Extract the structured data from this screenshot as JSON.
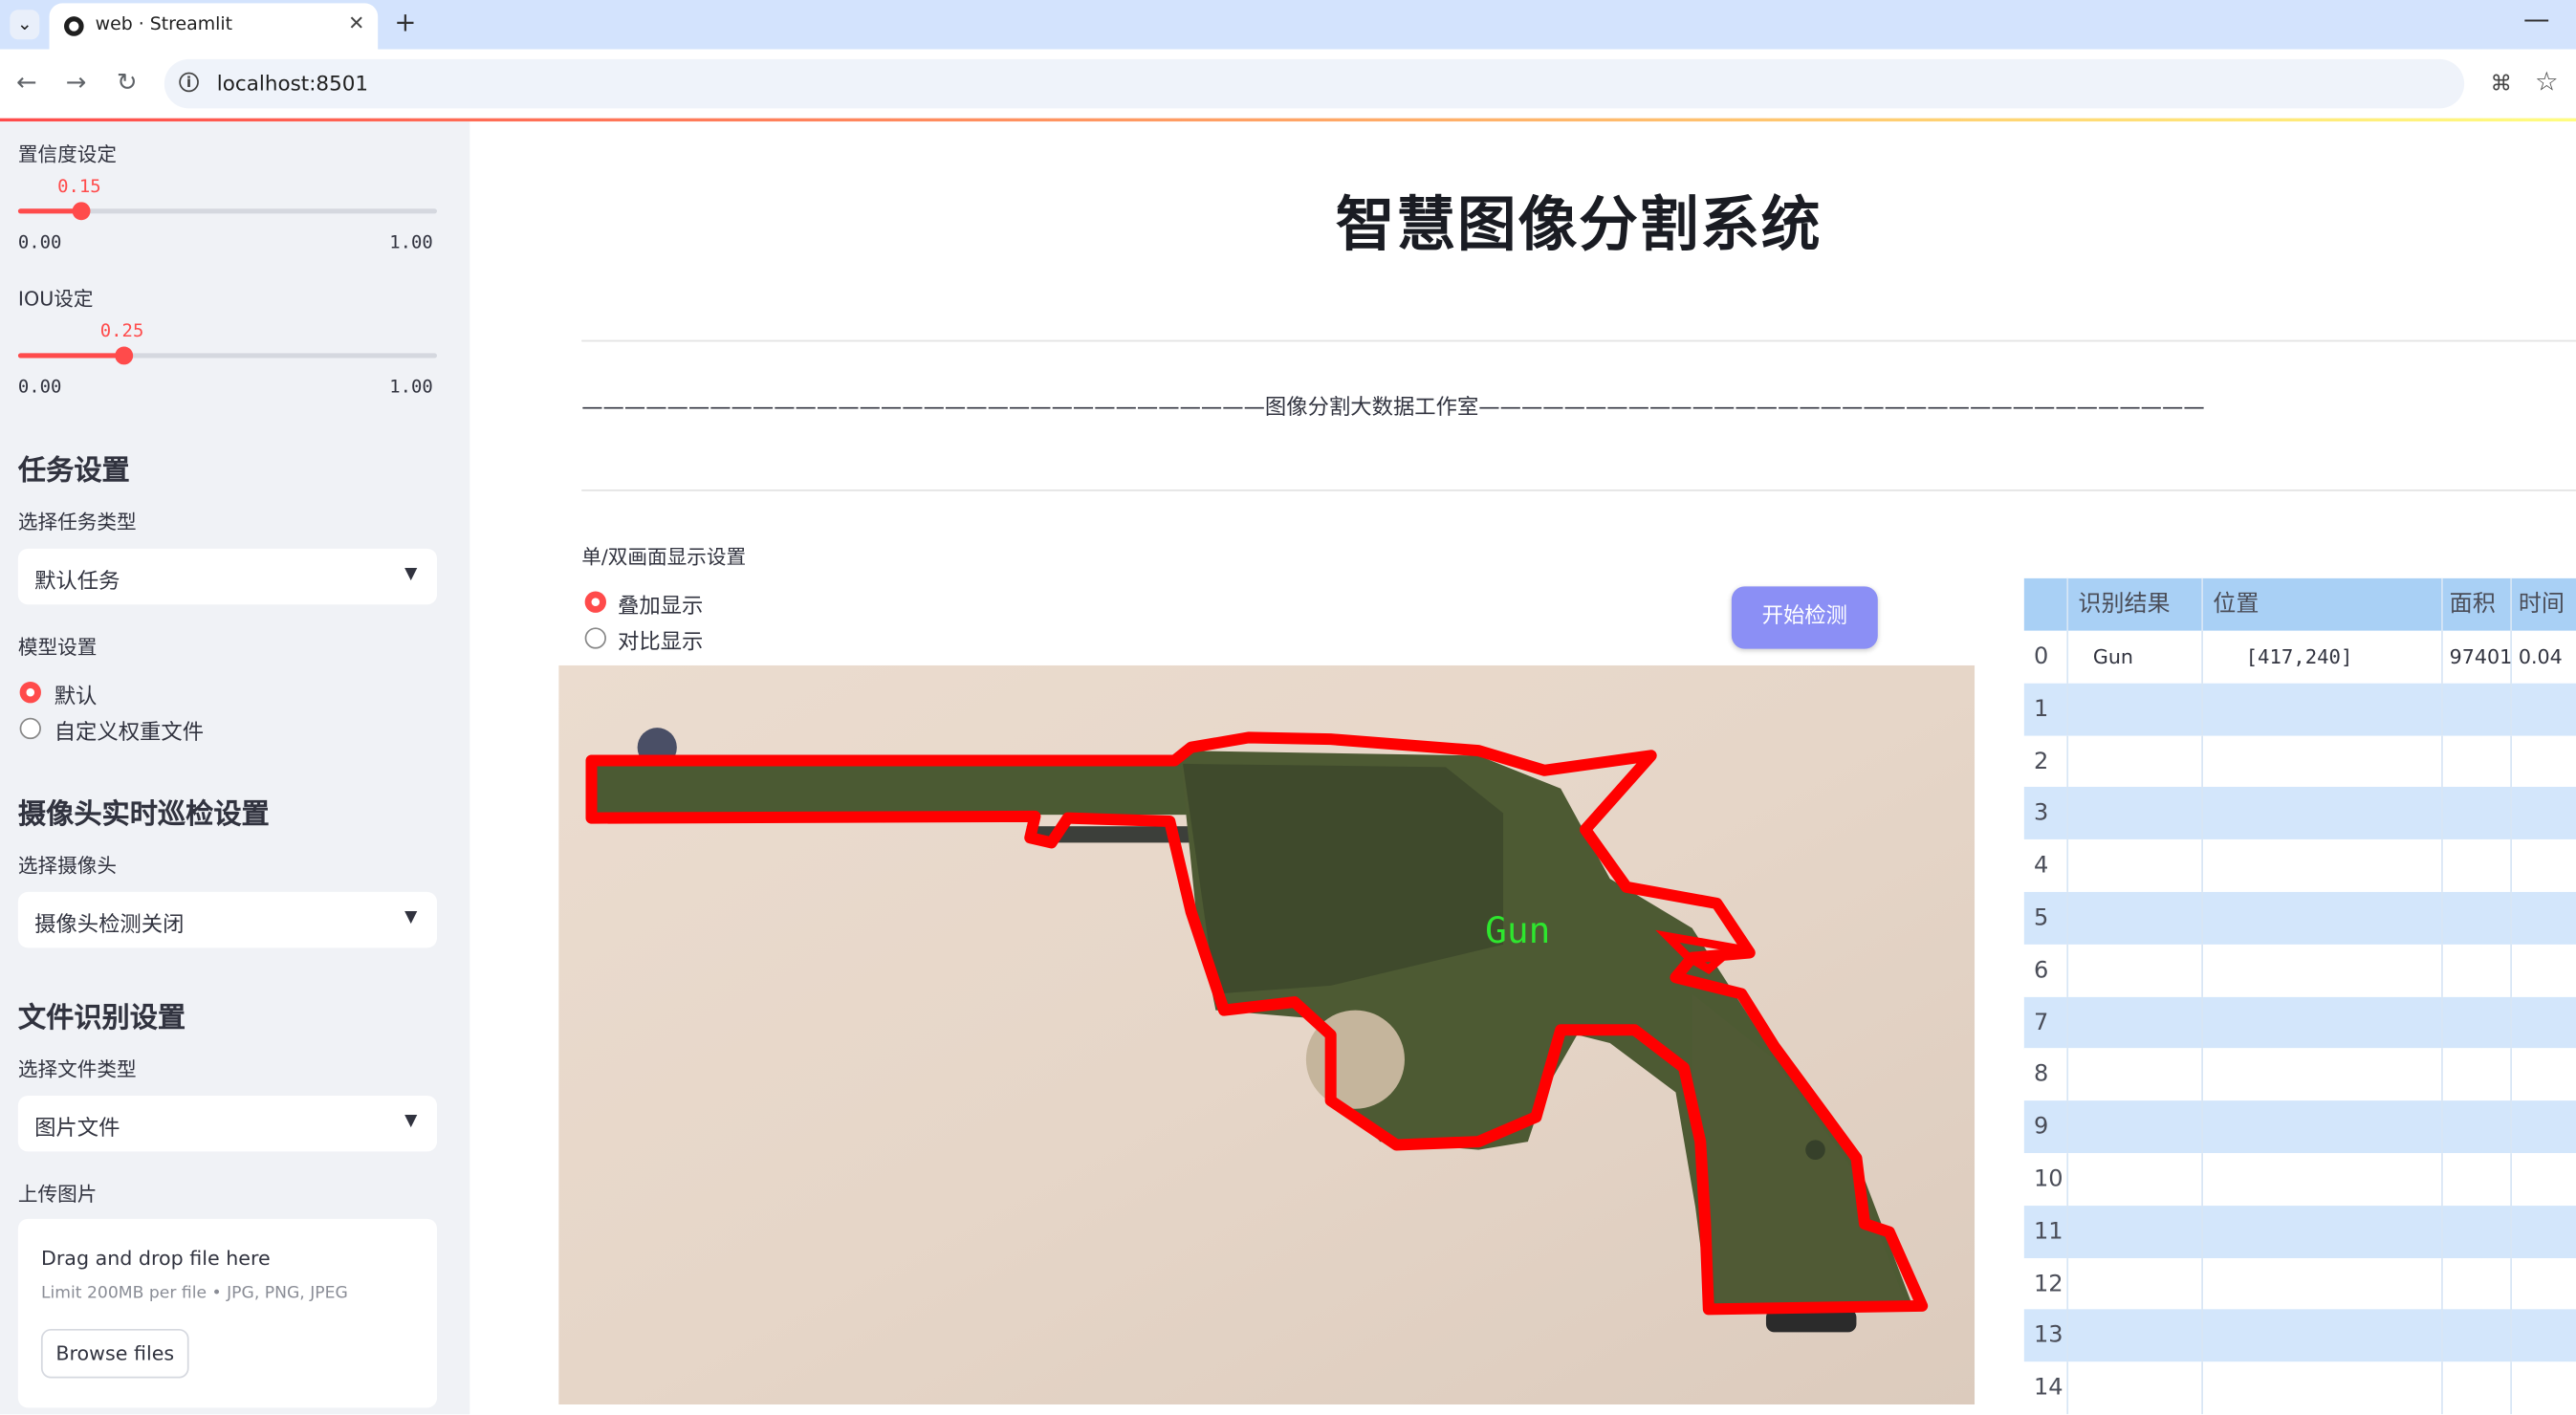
{
  "browser": {
    "tab_title": "web · Streamlit",
    "url": "localhost:8501",
    "nav": {
      "back": "←",
      "forward": "→",
      "reload": "↻"
    }
  },
  "sidebar": {
    "confidence": {
      "label": "置信度设定",
      "value": "0.15",
      "min": "0.00",
      "max": "1.00",
      "fraction": 0.15
    },
    "iou": {
      "label": "IOU设定",
      "value": "0.25",
      "min": "0.00",
      "max": "1.00",
      "fraction": 0.25
    },
    "task_section": "任务设置",
    "task_type_label": "选择任务类型",
    "task_type_value": "默认任务",
    "model_label": "模型设置",
    "model_options": [
      "默认",
      "自定义权重文件"
    ],
    "camera_section": "摄像头实时巡检设置",
    "camera_label": "选择摄像头",
    "camera_value": "摄像头检测关闭",
    "file_section": "文件识别设置",
    "file_type_label": "选择文件类型",
    "file_type_value": "图片文件",
    "upload_label": "上传图片",
    "upload_title": "Drag and drop file here",
    "upload_limit": "Limit 200MB per file • JPG, PNG, JPEG",
    "browse_label": "Browse files"
  },
  "main": {
    "title": "智慧图像分割系统",
    "studio": "————————————————————————————————图像分割大数据工作室——————————————————————————————————",
    "display_mode_label": "单/双画面显示设置",
    "display_modes": [
      "叠加显示",
      "对比显示"
    ],
    "detect_button": "开始检测",
    "detection_label": "Gun"
  },
  "results_table": {
    "headers": [
      "",
      "识别结果",
      "位置",
      "面积",
      "时间"
    ],
    "rows": [
      {
        "idx": "0",
        "result": "Gun",
        "position": "[417,240]",
        "area": "97401",
        "time": "0.04"
      },
      {
        "idx": "1",
        "result": "",
        "position": "",
        "area": "",
        "time": ""
      },
      {
        "idx": "2",
        "result": "",
        "position": "",
        "area": "",
        "time": ""
      },
      {
        "idx": "3",
        "result": "",
        "position": "",
        "area": "",
        "time": ""
      },
      {
        "idx": "4",
        "result": "",
        "position": "",
        "area": "",
        "time": ""
      },
      {
        "idx": "5",
        "result": "",
        "position": "",
        "area": "",
        "time": ""
      },
      {
        "idx": "6",
        "result": "",
        "position": "",
        "area": "",
        "time": ""
      },
      {
        "idx": "7",
        "result": "",
        "position": "",
        "area": "",
        "time": ""
      },
      {
        "idx": "8",
        "result": "",
        "position": "",
        "area": "",
        "time": ""
      },
      {
        "idx": "9",
        "result": "",
        "position": "",
        "area": "",
        "time": ""
      },
      {
        "idx": "10",
        "result": "",
        "position": "",
        "area": "",
        "time": ""
      },
      {
        "idx": "11",
        "result": "",
        "position": "",
        "area": "",
        "time": ""
      },
      {
        "idx": "12",
        "result": "",
        "position": "",
        "area": "",
        "time": ""
      },
      {
        "idx": "13",
        "result": "",
        "position": "",
        "area": "",
        "time": ""
      },
      {
        "idx": "14",
        "result": "",
        "position": "",
        "area": "",
        "time": ""
      }
    ]
  },
  "colors": {
    "accent": "#ff4b4b",
    "button": "#8b8ff5",
    "sidebar_bg": "#f0f2f6",
    "table_header": "#a9d0f5",
    "table_stripe": "#d3e6fb",
    "mask_outline": "#ff0000",
    "label_green": "#2ee62e"
  }
}
